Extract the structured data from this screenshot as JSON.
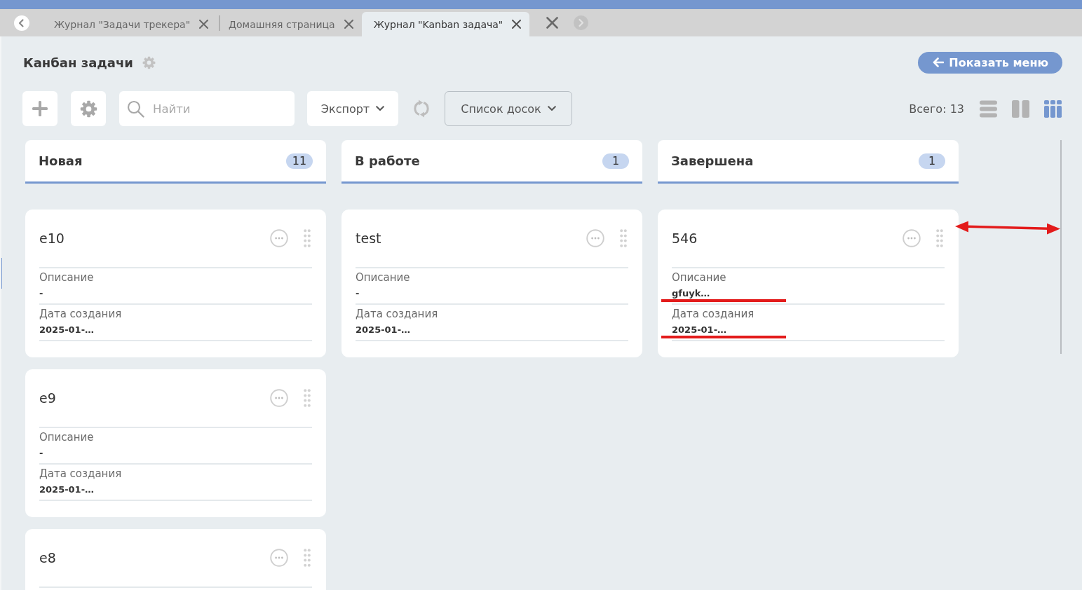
{
  "tabs": [
    {
      "label": "Журнал \"Задачи трекера\"",
      "selected": false
    },
    {
      "label": "Домашняя страница",
      "selected": false
    },
    {
      "label": "Журнал \"Kanban задача\"",
      "selected": true
    }
  ],
  "page": {
    "title": "Канбан задачи",
    "menu_button": "Показать меню"
  },
  "toolbar": {
    "search": {
      "placeholder": "Найти"
    },
    "export_button": "Экспорт",
    "boards_button": "Список досок",
    "total": "Всего: 13",
    "view_modes": [
      {
        "kind": "list",
        "selected": false
      },
      {
        "kind": "columns",
        "selected": false
      },
      {
        "kind": "kanban",
        "selected": true
      }
    ]
  },
  "board": {
    "width_arrow": true,
    "columns": [
      {
        "title": "Новая",
        "count": "11",
        "cards": [
          {
            "title": "e10",
            "fields": [
              {
                "label": "Описание",
                "value": "-",
                "underlined": false
              },
              {
                "label": "Дата создания",
                "value": "2025-01-…",
                "underlined": false
              }
            ]
          },
          {
            "title": "e9",
            "fields": [
              {
                "label": "Описание",
                "value": "-",
                "underlined": false
              },
              {
                "label": "Дата создания",
                "value": "2025-01-…",
                "underlined": false
              }
            ]
          },
          {
            "title": "e8"
          }
        ]
      },
      {
        "title": "В работе",
        "count": "1",
        "cards": [
          {
            "title": "test",
            "fields": [
              {
                "label": "Описание",
                "value": "-",
                "underlined": false
              },
              {
                "label": "Дата создания",
                "value": "2025-01-…",
                "underlined": false
              }
            ]
          }
        ]
      },
      {
        "title": "Завершена",
        "count": "1",
        "cards": [
          {
            "title": "546",
            "fields": [
              {
                "label": "Описание",
                "value": "gfuyk…",
                "underlined": true
              },
              {
                "label": "Дата создания",
                "value": "2025-01-…",
                "underlined": true
              }
            ]
          }
        ]
      }
    ]
  }
}
